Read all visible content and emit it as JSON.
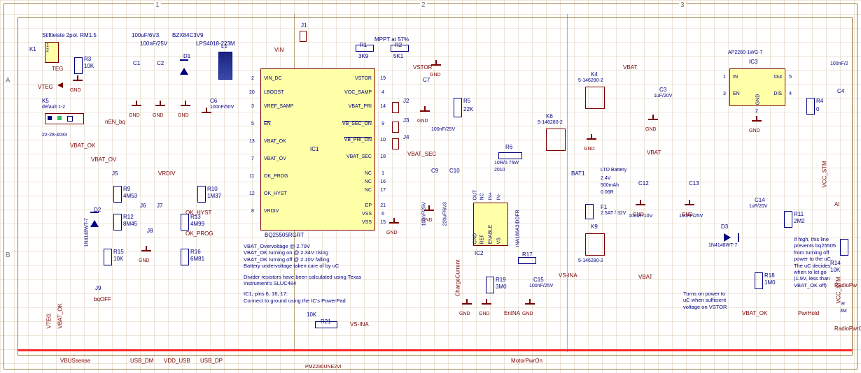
{
  "zone_labels": {
    "col1": "1",
    "col2": "2",
    "col3": "3",
    "rowA": "A",
    "rowB": "B"
  },
  "header_text": {
    "stiftleiste": "Stiftleiste 2pol. RM1.5",
    "k1": "K1",
    "c1val": "100uF/6V3",
    "bzx": "BZX84C3V9",
    "c2val": "100nF/25V",
    "lps": "LPS4018-223M",
    "j1": "J1",
    "mppt": "MPPT at 57%",
    "r1": "R1",
    "r1v": "3K9",
    "r2": "R2",
    "r2v": "5K1",
    "ap2280": "AP2280-1WG-7",
    "c4v": "100nF/2"
  },
  "ic1": {
    "ref": "IC1",
    "part": "BQ25505RGRT",
    "left": [
      {
        "n": "2",
        "t": "VIN_DC"
      },
      {
        "n": "20",
        "t": "LBOOST"
      },
      {
        "n": "3",
        "t": "VREF_SAMP"
      },
      {
        "n": "5",
        "t": "EN",
        "ov": true
      },
      {
        "n": "13",
        "t": "VBAT_OK"
      },
      {
        "n": "7",
        "t": "VBAT_OV"
      },
      {
        "n": "11",
        "t": "OK_PROG"
      },
      {
        "n": "12",
        "t": "OK_HYST"
      },
      {
        "n": "8",
        "t": "VRDIV"
      }
    ],
    "right": [
      {
        "n": "19",
        "t": "VSTOR"
      },
      {
        "n": "4",
        "t": "VOC_SAMP"
      },
      {
        "n": "14",
        "t": "VBAT_PRI"
      },
      {
        "n": "9",
        "t": "VB_SEC_ON",
        "ov": true
      },
      {
        "n": "10",
        "t": "VB_PRI_ON",
        "ov": true
      },
      {
        "n": "18",
        "t": "VBAT_SEC"
      },
      {
        "n": "1",
        "t": "NC"
      },
      {
        "n": "16",
        "t": "NC"
      },
      {
        "n": "17",
        "t": "NC"
      },
      {
        "n": "21",
        "t": "EP"
      },
      {
        "n": "6",
        "t": "VSS"
      },
      {
        "n": "15",
        "t": "VSS"
      }
    ]
  },
  "annot1": {
    "l1": "VBAT_Overvoltage @ 2.79V",
    "l2": "VBAT_OK turning on @ 2.34V rising",
    "l3": "VBAT_OK turning off @ 2.10V falling",
    "l4": "Battery undervoltage taken care of by uC",
    "l5": "Divider resistors have been calculated using Texas Instrument's SLUC484",
    "l6": "IC1, pins 6, 16, 17:",
    "l7": "Connect to ground using the IC's PowerPad"
  },
  "annot2": {
    "l1": "Turns on power to",
    "l2": "uC when sufficient",
    "l3": "voltage on VSTOR"
  },
  "annot3": {
    "l1": "If high, this line",
    "l2": "prevents bq25505",
    "l3": "from turning off",
    "l4": "power to the uC.",
    "l5": "The uC decides",
    "l6": "when to let go",
    "l7": "(1.9V, less than",
    "l8": "VBAT_OK off)"
  },
  "nets": {
    "vin": "VIN",
    "vteg": "VTEG",
    "nen_bq": "nEN_bq",
    "vbat_ok": "VBAT_OK",
    "vbat_ov": "VBAT_OV",
    "vrdiv": "VRDIV",
    "ok_hyst": "OK_HYST",
    "ok_prog": "OK_PROG",
    "bqoff": "bqOFF",
    "vstor": "VSTOR",
    "vbat_sec": "VBAT_SEC",
    "vs_ina": "VS-INA",
    "vbat": "VBAT",
    "enina": "EnINA",
    "charge": "ChargeCurrent",
    "motorpwr": "MotorPwrOn",
    "pwrhold": "PwrHold",
    "vcc_stm": "VCC_STM",
    "radiopwr": "RadioPwrOn",
    "vbussense": "VBUSsense",
    "usb_dm": "USB_DM",
    "vdd_usb": "VDD_USB",
    "usb_dp": "USB_DP",
    "pmz": "PMZ290UNE2VI",
    "vteg2": "VTEG",
    "vbat_ok_bot": "VBAT_OK",
    "radiopwo": "RadioPw"
  },
  "parts": {
    "k1": "K1",
    "teg": "TEG",
    "r3": "R3",
    "r3v": "10K",
    "c1": "C1",
    "c2": "C2",
    "d1": "D1",
    "c6": "C6",
    "c6v": "100nF/50V",
    "l1": "L1",
    "j2": "J2",
    "j3": "J3",
    "j4": "J4",
    "j5": "J5",
    "j6": "J6",
    "j7": "J7",
    "j8": "J8",
    "j9": "J9",
    "d2": "D2",
    "d2p": "1N4148WT-7",
    "r9": "R9",
    "r9v": "4M53",
    "r10": "R10",
    "r10v": "1M37",
    "r12": "R12",
    "r12v": "8M45",
    "r13": "R13",
    "r13v": "4M99",
    "r15": "R15",
    "r15v": "10K",
    "r16": "R16",
    "r16v": "6M81",
    "k5": "K5",
    "k5d": "default 1-2",
    "k5p": "22-28-4033",
    "r21": "R21",
    "r21v": "10K",
    "c7": "C7",
    "c7v": "100nF/25V",
    "r5": "R5",
    "r5v": "22K",
    "c9": "C9",
    "c9v": "100nF/25V",
    "c10": "C10",
    "c10v": "220uF/6V3",
    "ic2": "IC2",
    "ic2p": "INA186A3IDDFR",
    "r6": "R6",
    "r6v": "10R/0.75W",
    "r6y": "2010",
    "r17": "R17",
    "r19": "R19",
    "r19v": "3M0",
    "c15": "C15",
    "c15v": "100nF/25V",
    "k4": "K4",
    "k4p": "5-146280-2",
    "k6": "K6",
    "k6p": "5-146280-2",
    "k9": "K9",
    "k9p": "5-146280-2",
    "bat1": "BAT1",
    "batd": "LTO Battery",
    "batv": "2.4V",
    "batc": "500mAh",
    "batr": "0.06R",
    "f1": "F1",
    "f1v": "2.5AT / 32V",
    "c3": "C3",
    "c3v": "1uF/20V",
    "c12": "C12",
    "c12v": "100uF/10V",
    "c13": "C13",
    "c13v": "100nF/25V",
    "ic3": "IC3",
    "ic3in": "IN",
    "ic3out": "Out",
    "ic3en": "EN",
    "ic3gnd": "GND",
    "ic3dis": "DIS",
    "ic3n1": "1",
    "ic3n5": "5",
    "ic3n3": "3",
    "ic3n4": "4",
    "ic3n2": "2",
    "r4": "R4",
    "r4v": "0",
    "c4": "C4",
    "d3": "D3",
    "d3p": "1N4148WT-7",
    "r18": "R18",
    "r18v": "1M0",
    "r11": "R11",
    "r11v": "2M2",
    "c14": "C14",
    "c14v": "1uF/20V",
    "r14": "R14",
    "r14v": "10K",
    "al": "Al",
    "p3m": "3M",
    "r_generic": "R"
  },
  "ic2pins": {
    "out": "OUT",
    "nc": "NC",
    "inp": "IN+",
    "inm": "IN-",
    "gnd": "GND",
    "ref": "REF",
    "en": "ENABLE",
    "vs": "VS"
  },
  "gnd_label": "GND"
}
